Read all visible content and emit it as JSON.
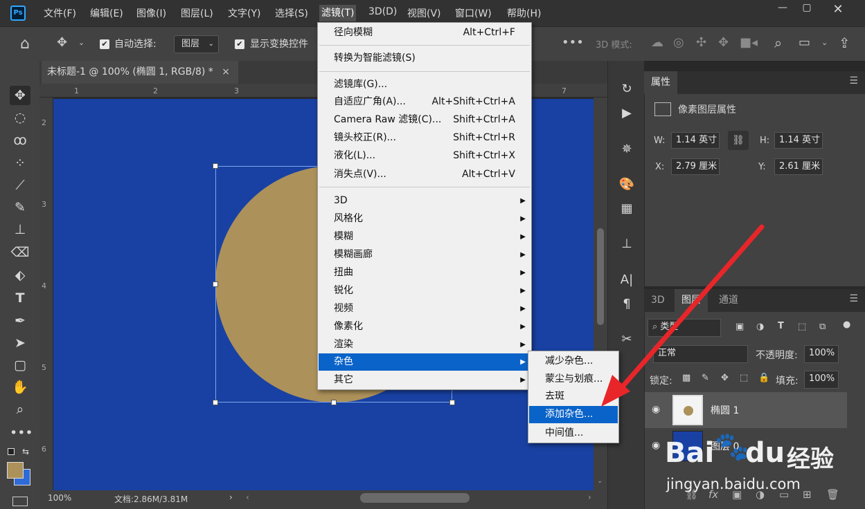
{
  "menubar": {
    "logo": "Ps",
    "items": [
      "文件(F)",
      "编辑(E)",
      "图像(I)",
      "图层(L)",
      "文字(Y)",
      "选择(S)",
      "滤镜(T)",
      "3D(D)",
      "视图(V)",
      "窗口(W)",
      "帮助(H)"
    ],
    "active_index": 6
  },
  "options": {
    "auto_select_label": "自动选择:",
    "auto_select_target": "图层",
    "show_transform_label": "显示变换控件",
    "mode_3d_label": "3D 模式:"
  },
  "document": {
    "tab_title": "未标题-1 @ 100% (椭圆 1, RGB/8) *",
    "close_glyph": "×",
    "ruler_top": [
      "1",
      "2",
      "3",
      "7"
    ],
    "ruler_left": [
      "2",
      "3",
      "4",
      "5",
      "6"
    ],
    "zoom": "100%",
    "doc_info": "文档:2.86M/3.81M"
  },
  "filter_menu": {
    "top_items": [
      {
        "label": "径向模糊",
        "shortcut": "Alt+Ctrl+F"
      },
      {
        "label": "转换为智能滤镜(S)",
        "shortcut": ""
      }
    ],
    "mid_items": [
      {
        "label": "滤镜库(G)...",
        "shortcut": ""
      },
      {
        "label": "自适应广角(A)...",
        "shortcut": "Alt+Shift+Ctrl+A"
      },
      {
        "label": "Camera Raw 滤镜(C)...",
        "shortcut": "Shift+Ctrl+A"
      },
      {
        "label": "镜头校正(R)...",
        "shortcut": "Shift+Ctrl+R"
      },
      {
        "label": "液化(L)...",
        "shortcut": "Shift+Ctrl+X"
      },
      {
        "label": "消失点(V)...",
        "shortcut": "Alt+Ctrl+V"
      }
    ],
    "sub_items": [
      "3D",
      "风格化",
      "模糊",
      "模糊画廊",
      "扭曲",
      "锐化",
      "视频",
      "像素化",
      "渲染",
      "杂色",
      "其它"
    ],
    "highlighted": "杂色"
  },
  "noise_submenu": {
    "items": [
      "减少杂色...",
      "蒙尘与划痕...",
      "去斑",
      "添加杂色...",
      "中间值..."
    ],
    "highlighted": "添加杂色..."
  },
  "properties": {
    "tab": "属性",
    "title": "像素图层属性",
    "w_label": "W:",
    "w_value": "1.14 英寸",
    "h_label": "H:",
    "h_value": "1.14 英寸",
    "x_label": "X:",
    "x_value": "2.79 厘米",
    "y_label": "Y:",
    "y_value": "2.61 厘米"
  },
  "layers": {
    "tabs": [
      "3D",
      "图层",
      "通道"
    ],
    "active_tab": "图层",
    "filter_kind": "类型",
    "blend_mode": "正常",
    "opacity_label": "不透明度:",
    "opacity_value": "100%",
    "lock_label": "锁定:",
    "fill_label": "填充:",
    "fill_value": "100%",
    "items": [
      {
        "name": "椭圆 1"
      },
      {
        "name": "图层 0"
      }
    ]
  },
  "colors": {
    "canvas": "#1841a3",
    "ellipse": "#ad915a",
    "highlight": "#0a63c9",
    "annotation_arrow": "#e8262a"
  },
  "watermark": {
    "brand": "Bai",
    "brand2": "du",
    "cn": "经验",
    "url": "jingyan.baidu.com"
  }
}
